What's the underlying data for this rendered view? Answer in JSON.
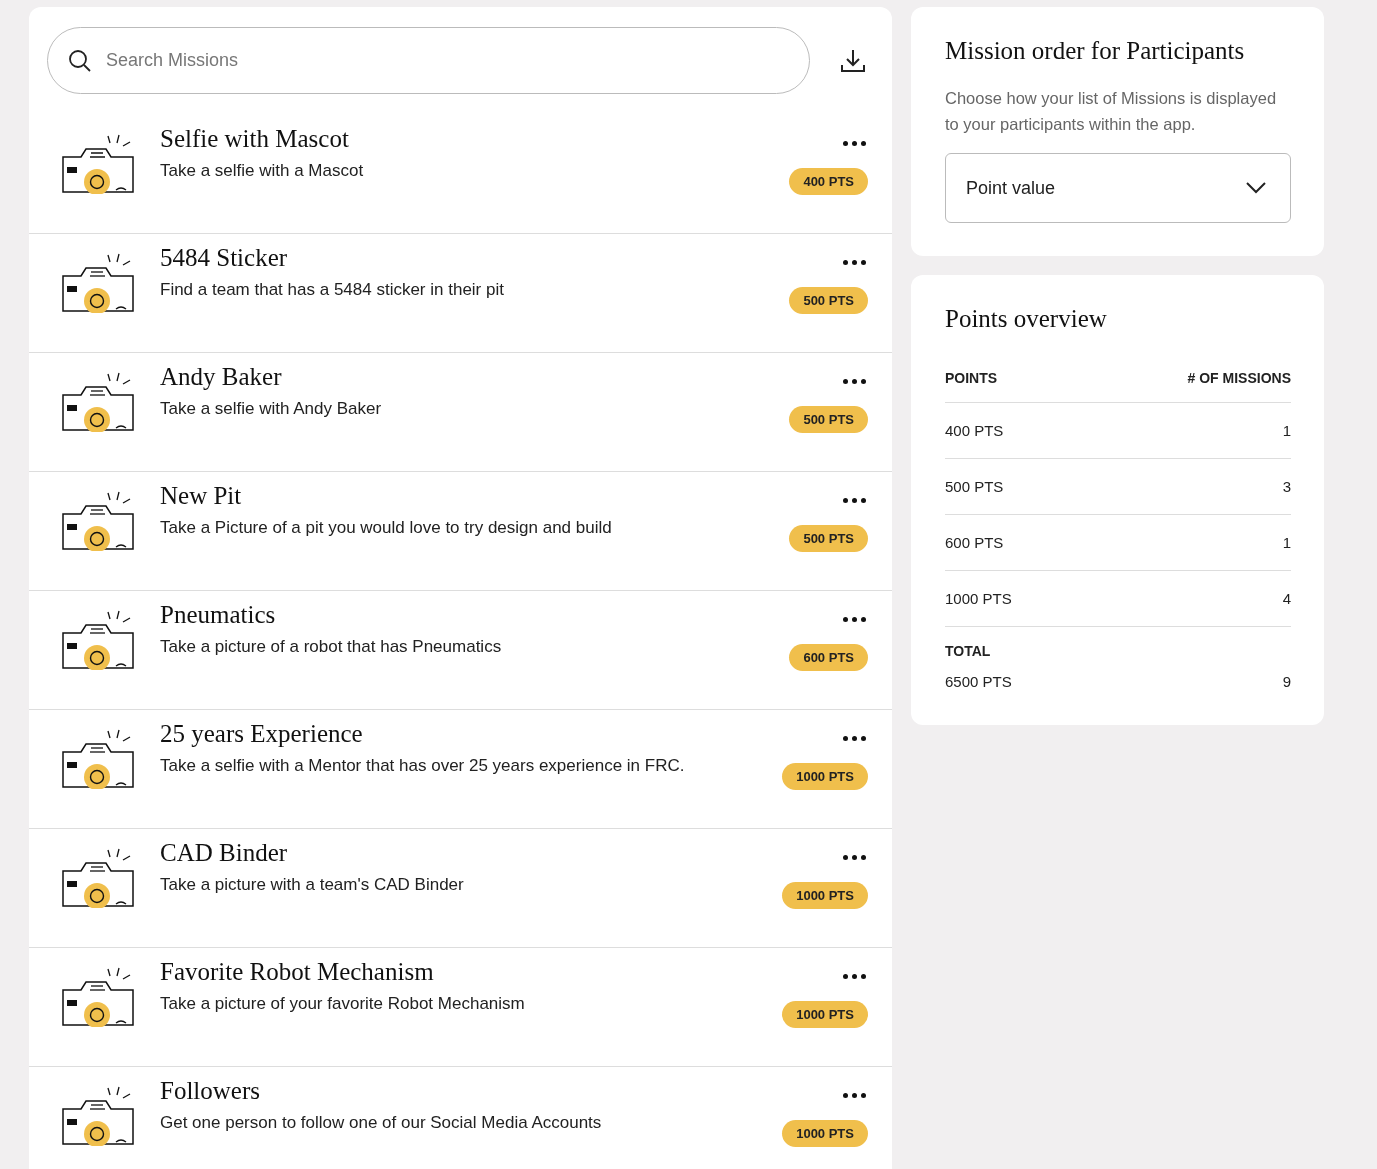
{
  "search": {
    "placeholder": "Search Missions"
  },
  "missions": [
    {
      "title": "Selfie with Mascot",
      "description": "Take a selfie with a Mascot",
      "points": "400 PTS"
    },
    {
      "title": "5484 Sticker",
      "description": "Find a team that has a 5484 sticker in their pit",
      "points": "500 PTS"
    },
    {
      "title": "Andy Baker",
      "description": "Take a selfie with Andy Baker",
      "points": "500 PTS"
    },
    {
      "title": "New Pit",
      "description": "Take a Picture of a pit you would love to try design and build",
      "points": "500 PTS"
    },
    {
      "title": "Pneumatics",
      "description": "Take a picture of a robot that has Pneumatics",
      "points": "600 PTS"
    },
    {
      "title": "25 years Experience",
      "description": "Take a selfie with a Mentor that has over 25 years experience in FRC.",
      "points": "1000 PTS"
    },
    {
      "title": "CAD Binder",
      "description": "Take a picture with a team's CAD Binder",
      "points": "1000 PTS"
    },
    {
      "title": "Favorite Robot Mechanism",
      "description": "Take a picture of your favorite Robot Mechanism",
      "points": "1000 PTS"
    },
    {
      "title": "Followers",
      "description": "Get one person to follow one of our Social Media Accounts",
      "points": "1000 PTS"
    }
  ],
  "order": {
    "title": "Mission order for Participants",
    "description": "Choose how your list of Missions is displayed to your participants within the app.",
    "value": "Point value"
  },
  "overview": {
    "title": "Points overview",
    "columns": [
      "POINTS",
      "# OF MISSIONS"
    ],
    "rows": [
      {
        "points": "400 PTS",
        "count": "1"
      },
      {
        "points": "500 PTS",
        "count": "3"
      },
      {
        "points": "600 PTS",
        "count": "1"
      },
      {
        "points": "1000 PTS",
        "count": "4"
      }
    ],
    "total_label": "TOTAL",
    "total": {
      "points": "6500 PTS",
      "count": "9"
    }
  }
}
